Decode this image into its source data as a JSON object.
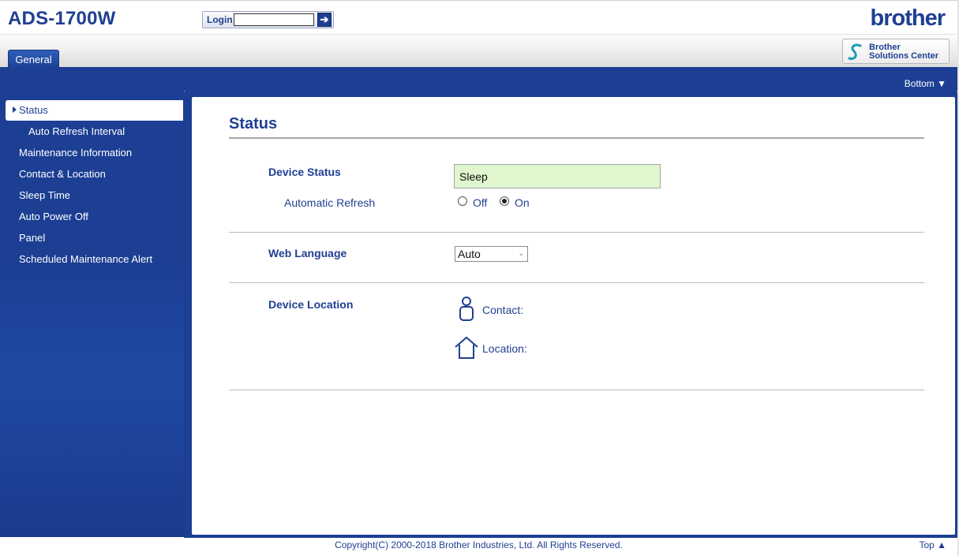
{
  "header": {
    "model": "ADS-1700W",
    "login_label": "Login",
    "login_value": "",
    "login_go_icon": "arrow-right-icon",
    "brand": "brother",
    "solutions_center_line1": "Brother",
    "solutions_center_line2": "Solutions Center"
  },
  "tabs": [
    {
      "label": "General",
      "active": true
    }
  ],
  "nav": {
    "bottom_link": "Bottom ▼",
    "top_link": "Top ▲"
  },
  "sidebar": {
    "items": [
      {
        "label": "Status",
        "active": true
      },
      {
        "label": "Auto Refresh Interval",
        "sub": true
      },
      {
        "label": "Maintenance Information"
      },
      {
        "label": "Contact & Location"
      },
      {
        "label": "Sleep Time"
      },
      {
        "label": "Auto Power Off"
      },
      {
        "label": "Panel"
      },
      {
        "label": "Scheduled Maintenance Alert"
      }
    ]
  },
  "main": {
    "title": "Status",
    "device_status_label": "Device Status",
    "device_status_value": "Sleep",
    "auto_refresh_label": "Automatic Refresh",
    "auto_refresh_off": "Off",
    "auto_refresh_on": "On",
    "auto_refresh_selected": "On",
    "web_language_label": "Web Language",
    "web_language_value": "Auto",
    "device_location_label": "Device Location",
    "contact_label": "Contact:",
    "location_label": "Location:"
  },
  "footer": {
    "copyright": "Copyright(C) 2000-2018 Brother Industries, Ltd. All Rights Reserved."
  },
  "colors": {
    "brand_blue": "#1f3f92",
    "band_blue": "#1c3f94",
    "status_green": "#dff6cf"
  }
}
